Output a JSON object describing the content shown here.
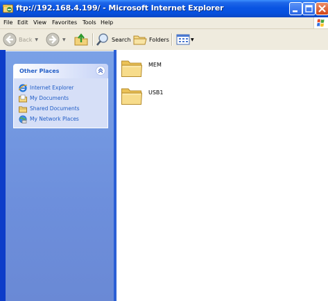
{
  "window": {
    "title": "ftp://192.168.4.199/ - Microsoft Internet Explorer",
    "minimize_icon": "minimize-icon",
    "maximize_icon": "maximize-icon",
    "close_icon": "close-icon"
  },
  "menubar": {
    "items": [
      "File",
      "Edit",
      "View",
      "Favorites",
      "Tools",
      "Help"
    ]
  },
  "toolbar": {
    "back_label": "Back",
    "search_label": "Search",
    "folders_label": "Folders"
  },
  "taskpane": {
    "other_places": {
      "title": "Other Places",
      "items": [
        {
          "label": "Internet Explorer",
          "icon": "internet-explorer-icon"
        },
        {
          "label": "My Documents",
          "icon": "my-documents-icon"
        },
        {
          "label": "Shared Documents",
          "icon": "shared-documents-icon"
        },
        {
          "label": "My Network Places",
          "icon": "network-places-icon"
        }
      ]
    },
    "colors": {
      "link": "#215dc6",
      "pane": "#6d8fdc"
    }
  },
  "content": {
    "folders": [
      {
        "name": "MEM",
        "icon": "folder-icon"
      },
      {
        "name": "USB1",
        "icon": "folder-icon"
      }
    ]
  }
}
